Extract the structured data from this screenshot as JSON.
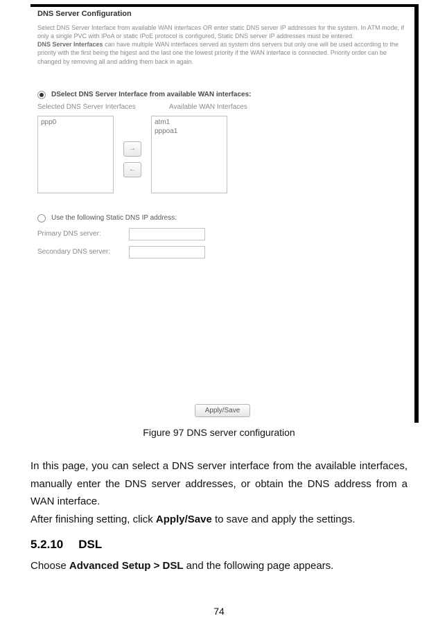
{
  "embedded": {
    "title": "DNS Server Configuration",
    "desc_line1a": "Select DNS Server Interface from available WAN interfaces OR enter static DNS server IP addresses for the system. In ATM mode, if only a single PVC with IPoA or static IPoE protocol is configured, Static DNS server IP addresses must be entered.",
    "desc_line2_bold": "DNS Server Interfaces",
    "desc_line2_rest": " can have multiple WAN interfaces served as system dns servers but only one will be used according to the priority with the first being the higest and the last one the lowest priority if the WAN interface is connected. Priority order can be changed by removing all and adding them back in again.",
    "radio1_prefix": "D",
    "radio1_label": "Select DNS Server Interface from available WAN interfaces:",
    "col1_label": "Selected DNS Server Interfaces",
    "col2_label": "Available WAN Interfaces",
    "list1_item1": "ppp0",
    "list2_item1": "atm1",
    "list2_item2": "pppoa1",
    "arrow_right": "→",
    "arrow_left": "←",
    "radio2_label": "Use the following Static DNS IP address:",
    "field1_label": "Primary DNS server:",
    "field2_label": "Secondary DNS server:",
    "apply_save": "Apply/Save"
  },
  "caption": "Figure 97 DNS server configuration",
  "para1": "In this page, you can select a DNS server interface from the available interfaces, manually enter the DNS server addresses, or obtain the DNS address from a WAN interface.",
  "para2_a": "After finishing setting, click ",
  "para2_b": "Apply/Save",
  "para2_c": " to save and apply the settings.",
  "heading_num": "5.2.10",
  "heading_text": "DSL",
  "para3_a": "Choose ",
  "para3_b": "Advanced Setup > DSL",
  "para3_c": " and the following page appears.",
  "page_number": "74"
}
